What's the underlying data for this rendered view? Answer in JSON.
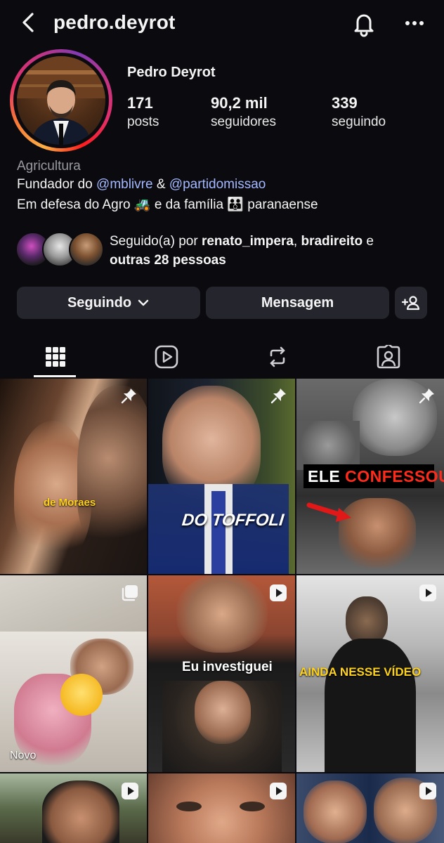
{
  "header": {
    "username": "pedro.deyrot",
    "back_icon": "chevron-left-icon",
    "bell_icon": "bell-icon",
    "more_icon": "more-horizontal-icon"
  },
  "profile": {
    "display_name": "Pedro Deyrot",
    "stats": [
      {
        "value": "171",
        "label": "posts"
      },
      {
        "value": "90,2 mil",
        "label": "seguidores"
      },
      {
        "value": "339",
        "label": "seguindo"
      }
    ],
    "category": "Agricultura",
    "bio_line1": {
      "prefix": "Fundador do ",
      "mention1": "@mblivre",
      "mid": " & ",
      "mention2": "@partidomissao"
    },
    "bio_line2": "Em defesa do Agro 🚜 e da família 👪 paranaense",
    "followed_by": {
      "prefix": "Seguido(a) por ",
      "user1": "renato_impera",
      "sep": ", ",
      "user2": "bradireito",
      "and": " e",
      "rest": "outras 28 pessoas"
    }
  },
  "actions": {
    "following_label": "Seguindo",
    "message_label": "Mensagem",
    "add_user_icon": "add-user-icon"
  },
  "tabs": [
    {
      "name": "grid",
      "icon": "grid-icon",
      "active": true
    },
    {
      "name": "reels",
      "icon": "reels-icon",
      "active": false
    },
    {
      "name": "reposts",
      "icon": "repost-icon",
      "active": false
    },
    {
      "name": "tagged",
      "icon": "tagged-icon",
      "active": false
    }
  ],
  "posts": [
    {
      "caption": "de Moraes",
      "badge": "pin-icon"
    },
    {
      "caption": "DO TOFFOLI",
      "badge": "pin-icon"
    },
    {
      "caption_a": "ELE ",
      "caption_b": "CONFESSOU",
      "badge": "pin-icon"
    },
    {
      "caption": "Novo",
      "badge": "carousel-icon"
    },
    {
      "caption": "Eu investiguei",
      "badge": "reel-icon"
    },
    {
      "caption": "AINDA NESSE VÍDEO",
      "badge": "reel-icon"
    },
    {
      "badge": "reel-icon"
    },
    {
      "badge": "reel-icon"
    },
    {
      "badge": "reel-icon"
    }
  ],
  "colors": {
    "background": "#0b0b0f",
    "button": "#25262d",
    "mention": "#a4b8ff",
    "caption_yellow": "#ffd21a",
    "caption_red": "#ff2a1a"
  }
}
